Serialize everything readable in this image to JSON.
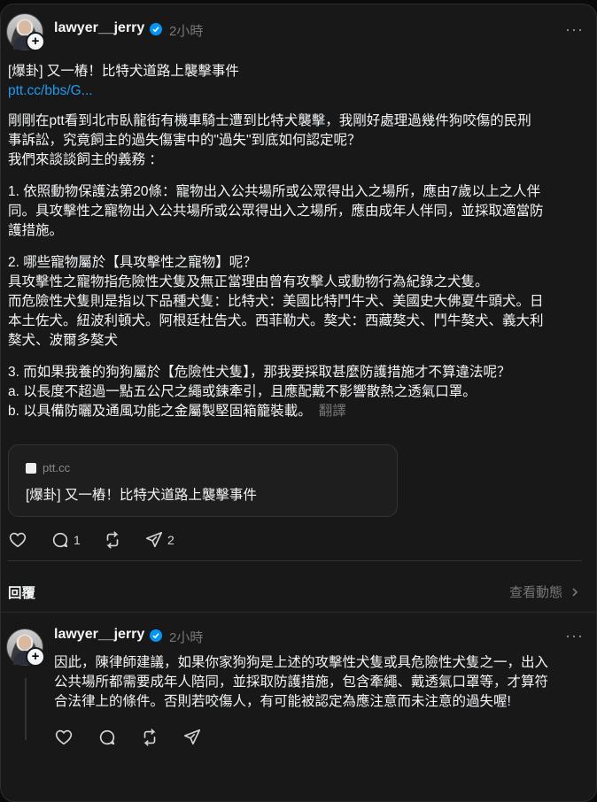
{
  "post": {
    "username": "lawyer__jerry",
    "time": "2小時",
    "more": "···",
    "title": "[爆卦] 又一樁！比特犬道路上襲擊事件",
    "link": "ptt.cc/bbs/G...",
    "body1": "剛剛在ptt看到北市臥龍街有機車騎士遭到比特犬襲擊，我剛好處理過幾件狗咬傷的民刑\n事訴訟，究竟飼主的過失傷害中的\"過失\"到底如何認定呢？\n我們來談談飼主的義務 ：",
    "body2": "1. 依照動物保護法第20條：寵物出入公共場所或公眾得出入之場所，應由7歲以上之人伴\n同。具攻擊性之寵物出入公共場所或公眾得出入之場所，應由成年人伴同，並採取適當防\n護措施。",
    "body3": "2. 哪些寵物屬於【具攻擊性之寵物】呢？\n具攻擊性之寵物指危險性犬隻及無正當理由曾有攻擊人或動物行為紀錄之犬隻。\n而危險性犬隻則是指以下品種犬隻：比特犬：美國比特鬥牛犬、美國史大佛夏牛頭犬。日\n本土佐犬。紐波利頓犬。阿根廷杜告犬。西菲勒犬。獒犬：西藏獒犬、鬥牛獒犬、義大利\n獒犬、波爾多獒犬",
    "body4": "3. 而如果我養的狗狗屬於【危險性犬隻】，那我要採取甚麼防護措施才不算違法呢？\na. 以長度不超過一點五公尺之繩或鍊牽引，且應配戴不影響散熱之透氣口罩。\nb. 以具備防曬及通風功能之金屬製堅固箱籠裝載。",
    "translate": "翻譯",
    "linkcard": {
      "domain": "ptt.cc",
      "title": "[爆卦] 又一樁！比特犬道路上襲擊事件"
    },
    "actions": {
      "comments": "1",
      "shares": "2"
    }
  },
  "section": {
    "replies_label": "回覆",
    "activity_label": "查看動態"
  },
  "reply": {
    "username": "lawyer__jerry",
    "time": "2小時",
    "more": "···",
    "body": "因此，陳律師建議，如果你家狗狗是上述的攻擊性犬隻或具危險性犬隻之一，出入\n公共場所都需要成年人陪同，並採取防護措施，包含牽繩、戴透氣口罩等，才算符\n合法律上的條件。否則若咬傷人，有可能被認定為應注意而未注意的過失喔!"
  },
  "icons": [
    "plus-icon",
    "verified-icon",
    "more-icon",
    "heart-icon",
    "comment-icon",
    "repost-icon",
    "share-icon",
    "chevron-right-icon"
  ],
  "colors": {
    "background": "#181818",
    "link": "#1d9bf0",
    "verified": "#0095f6",
    "muted": "#777777"
  }
}
